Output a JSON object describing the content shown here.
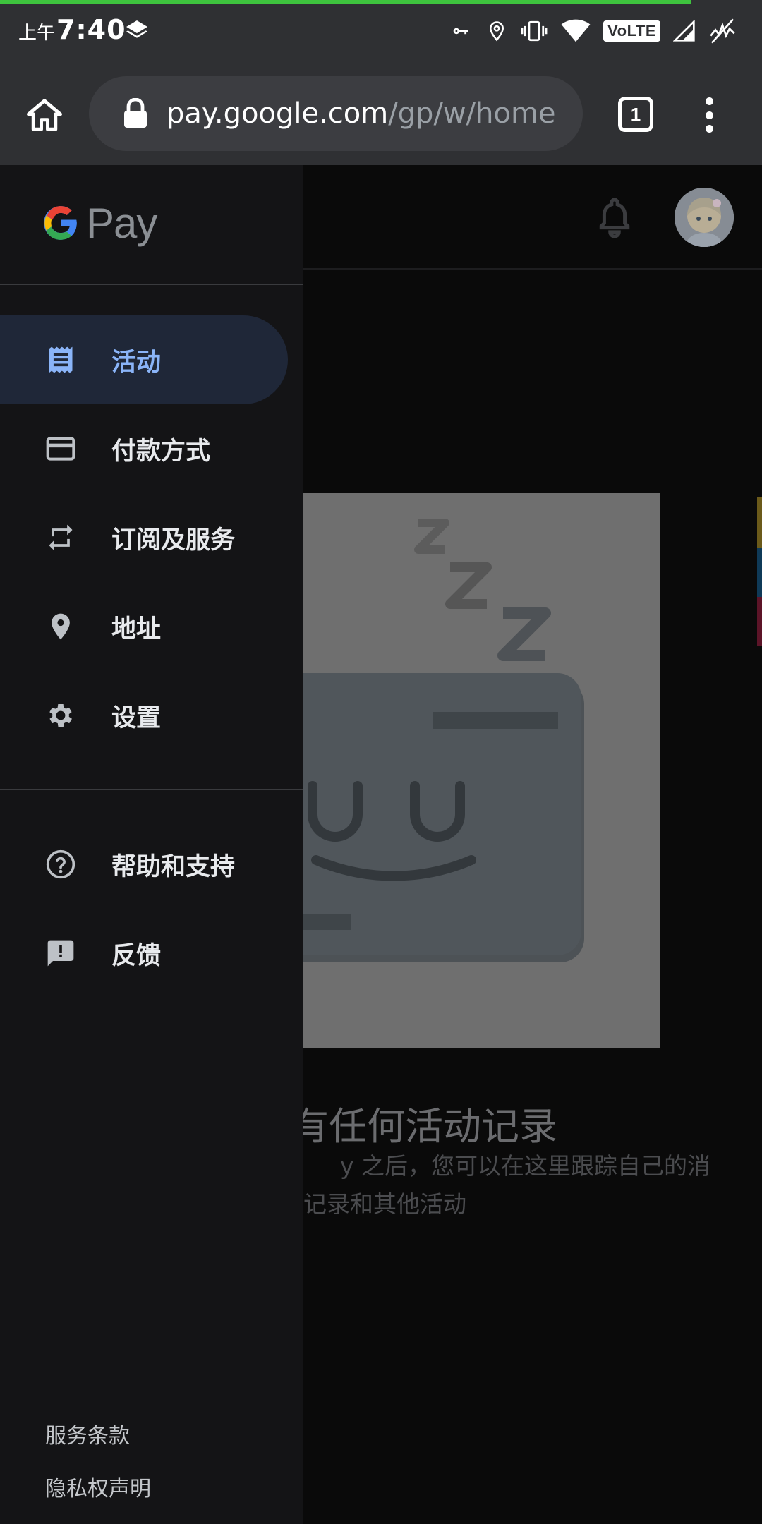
{
  "status_bar": {
    "ampm": "上午",
    "time": "7:40",
    "network_badge": "VoLTE",
    "icons": [
      "layers-icon",
      "vpn-key-icon",
      "location-icon",
      "vibrate-icon",
      "wifi-icon",
      "volte-icon",
      "signal-icon",
      "signal-no-data-icon"
    ]
  },
  "browser": {
    "url_host": "pay.google.com",
    "url_path": "/gp/w/home",
    "tab_count": "1",
    "icons": [
      "home-icon",
      "lock-icon",
      "tab-switcher-icon",
      "more-vert-icon"
    ]
  },
  "page": {
    "empty_title": "有任何活动记录",
    "empty_desc_line1": "y 之后，您可以在这里跟踪自己的消",
    "empty_desc_line2": "记录和其他活动",
    "icons": [
      "notifications-bell-icon",
      "profile-avatar"
    ]
  },
  "drawer": {
    "logo_text": "Pay",
    "nav_items": [
      {
        "label": "活动",
        "icon": "receipt-icon",
        "active": true
      },
      {
        "label": "付款方式",
        "icon": "credit-card-icon",
        "active": false
      },
      {
        "label": "订阅及服务",
        "icon": "repeat-icon",
        "active": false
      },
      {
        "label": "地址",
        "icon": "location-pin-icon",
        "active": false
      },
      {
        "label": "设置",
        "icon": "settings-gear-icon",
        "active": false
      }
    ],
    "secondary_items": [
      {
        "label": "帮助和支持",
        "icon": "help-circle-icon"
      },
      {
        "label": "反馈",
        "icon": "feedback-icon"
      }
    ],
    "footer_links": [
      "服务条款",
      "隐私权声明"
    ]
  },
  "colors": {
    "active_accent": "#8ab4f8",
    "active_bg": "#1f2738",
    "drawer_bg": "#141416",
    "toolbar_bg": "#2f3033",
    "progress_green": "#3ec33e"
  }
}
